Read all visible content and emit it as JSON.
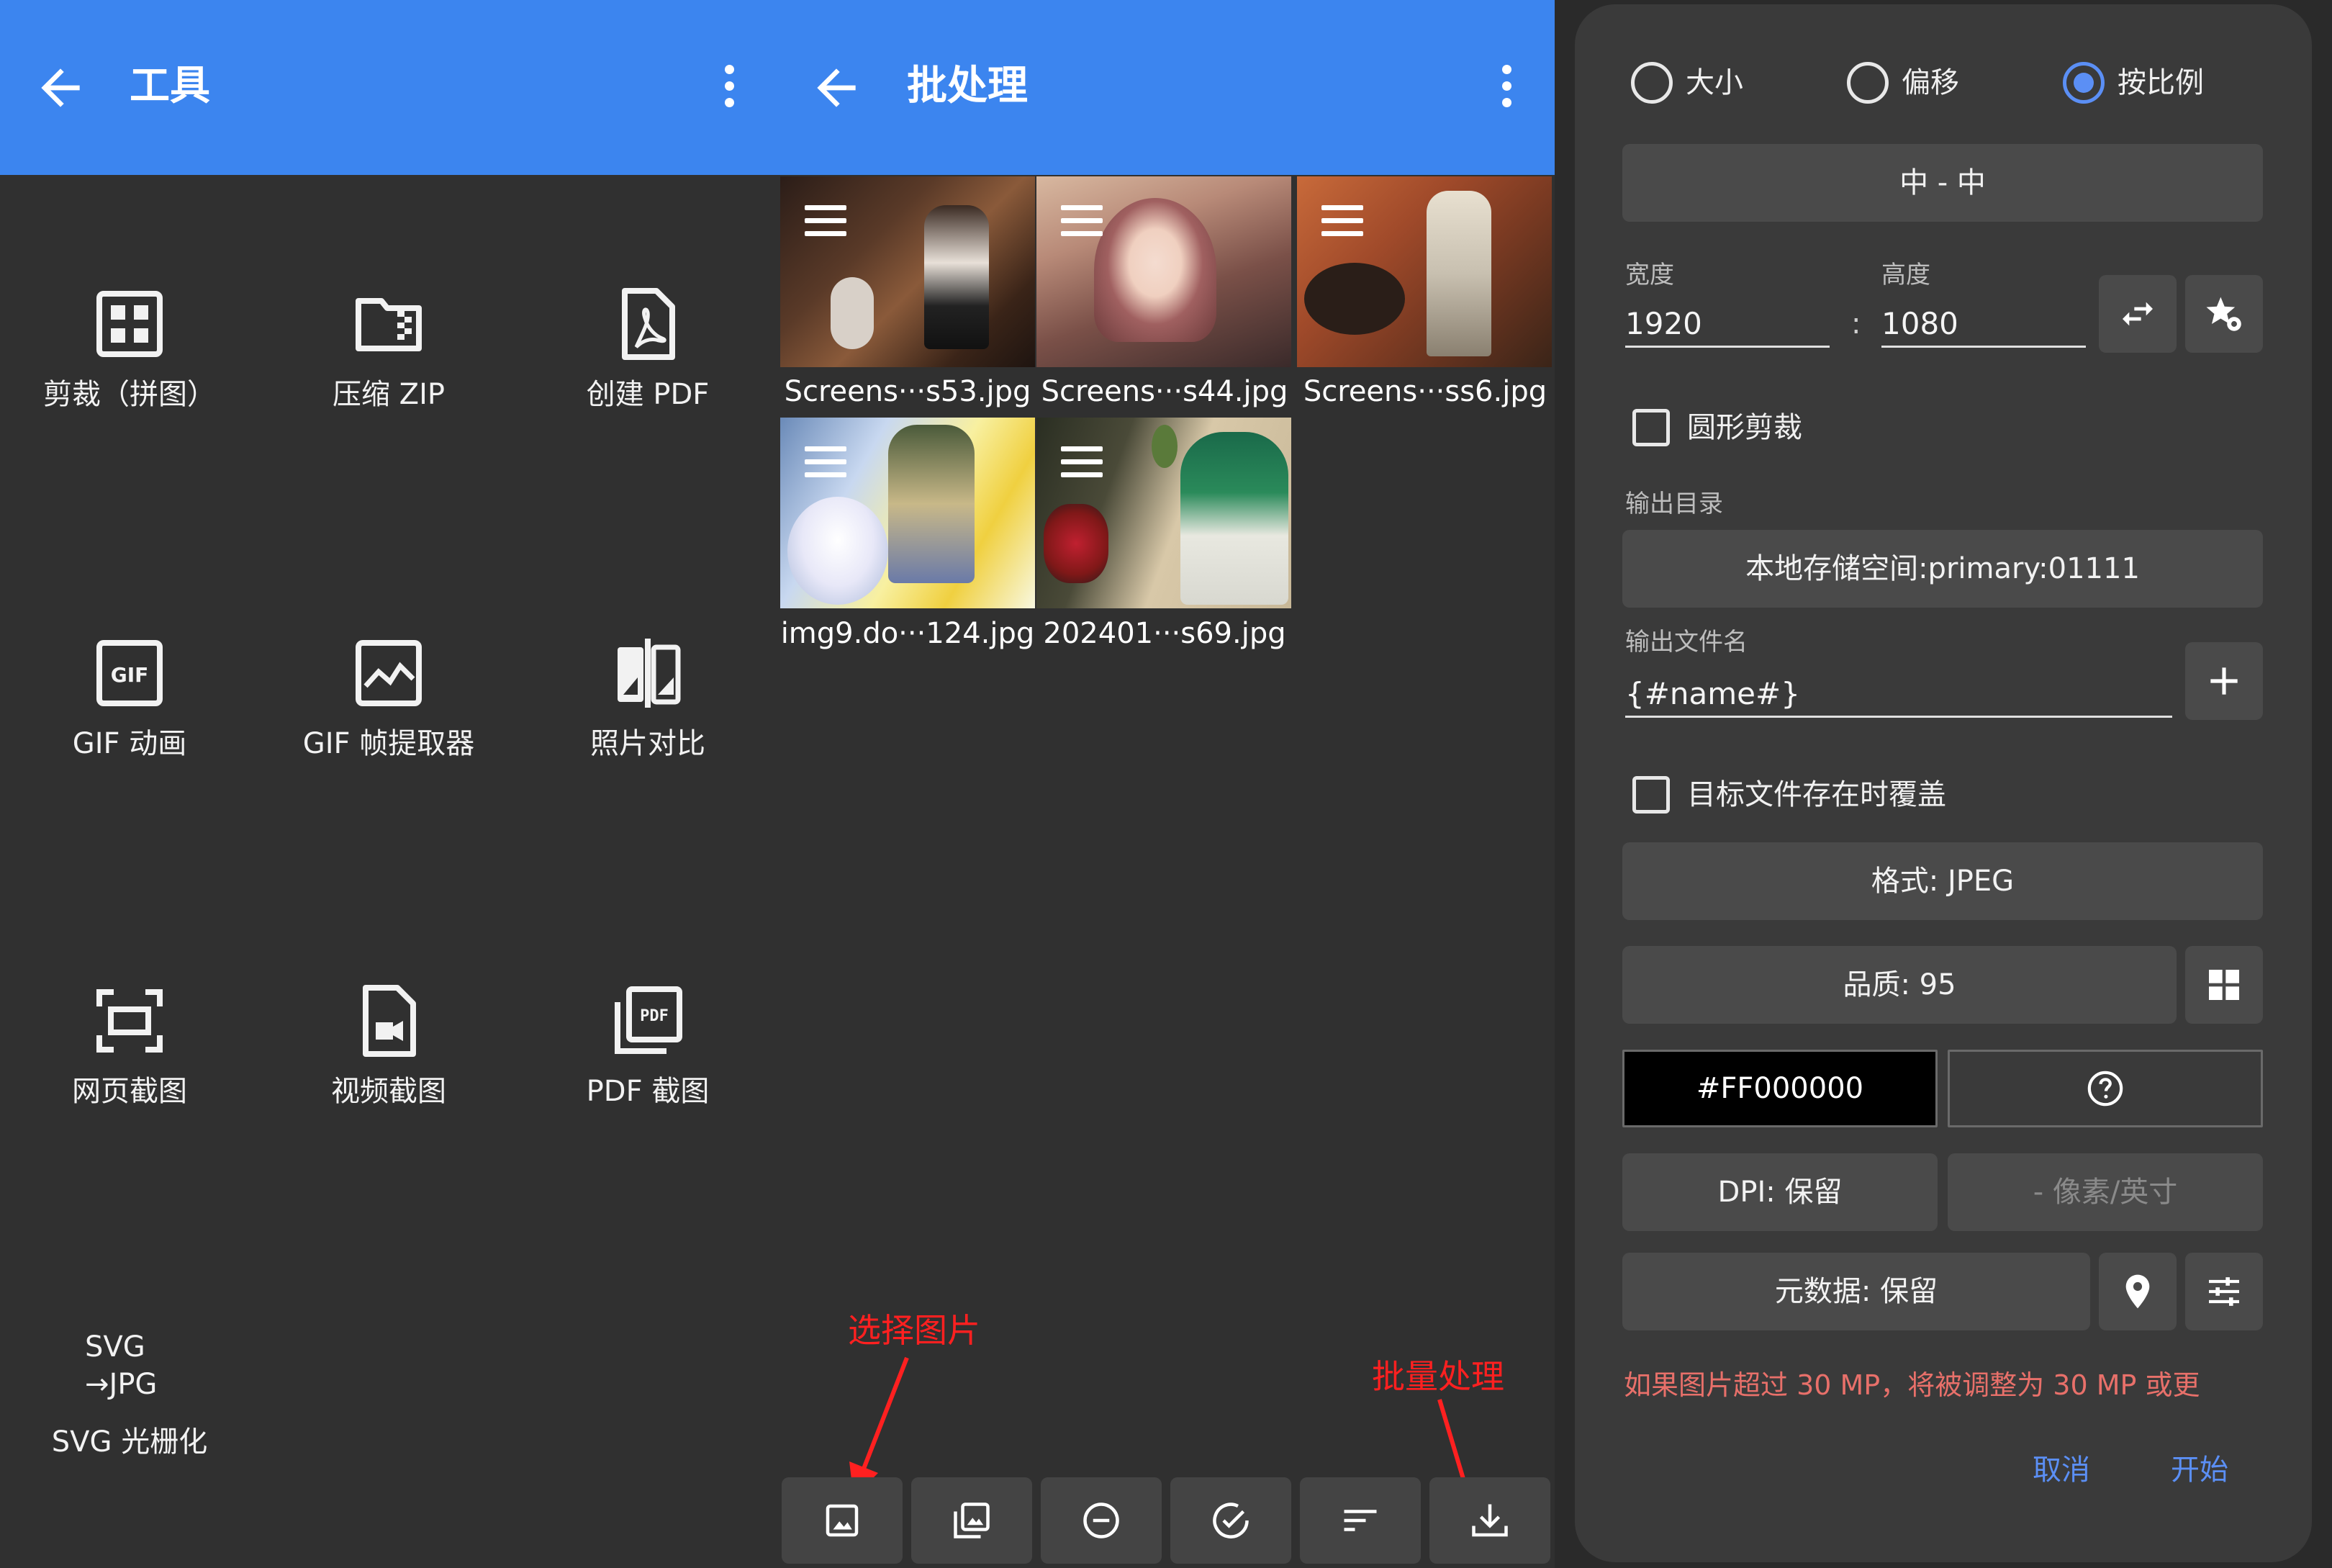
{
  "colors": {
    "appbar": "#3c85ef",
    "background": "#303030",
    "dialog": "#3a3a3a",
    "button": "#4a4a4a",
    "accent": "#5b8ff5",
    "warning": "#e8706a",
    "annotation": "#ff2020"
  },
  "tools_pane": {
    "title": "工具",
    "back_icon": "arrow-left-icon",
    "more_icon": "more-vert-icon",
    "items": [
      {
        "label": "剪裁（拼图）",
        "icon": "grid-icon"
      },
      {
        "label": "压缩 ZIP",
        "icon": "folder-zip-icon"
      },
      {
        "label": "创建 PDF",
        "icon": "pdf-file-icon"
      },
      {
        "label": "GIF 动画",
        "icon": "gif-icon"
      },
      {
        "label": "GIF 帧提取器",
        "icon": "image-frame-icon"
      },
      {
        "label": "照片对比",
        "icon": "compare-icon"
      },
      {
        "label": "网页截图",
        "icon": "screenshot-icon"
      },
      {
        "label": "视频截图",
        "icon": "video-file-icon"
      },
      {
        "label": "PDF 截图",
        "icon": "pdf-stack-icon"
      },
      {
        "label": "SVG 光栅化",
        "icon": "svg-to-jpg-icon",
        "icon_text_1": "SVG",
        "icon_text_2": "→JPG"
      }
    ]
  },
  "batch_pane": {
    "title": "批处理",
    "images": [
      {
        "name": "Screens···s53.jpg"
      },
      {
        "name": "Screens···s44.jpg"
      },
      {
        "name": "Screens···ss6.jpg"
      },
      {
        "name": "img9.do···124.jpg"
      },
      {
        "name": "202401···s69.jpg"
      }
    ],
    "toolbar": [
      {
        "name": "select-image",
        "icon": "image-icon"
      },
      {
        "name": "select-images",
        "icon": "image-multiple-icon"
      },
      {
        "name": "remove",
        "icon": "minus-circle-icon"
      },
      {
        "name": "select-all",
        "icon": "check-circle-icon"
      },
      {
        "name": "sort",
        "icon": "sort-icon"
      },
      {
        "name": "batch-process",
        "icon": "download-icon"
      }
    ],
    "annotations": {
      "select_image": "选择图片",
      "batch_process": "批量处理"
    }
  },
  "dialog": {
    "radios": [
      {
        "label": "大小",
        "checked": false
      },
      {
        "label": "偏移",
        "checked": false
      },
      {
        "label": "按比例",
        "checked": true
      }
    ],
    "gravity_button": "中 - 中",
    "width_label": "宽度",
    "width_value": "1920",
    "separator": ":",
    "height_label": "高度",
    "height_value": "1080",
    "circle_crop_label": "圆形剪裁",
    "circle_crop_checked": false,
    "output_dir_label": "输出目录",
    "output_dir_value": "本地存储空间:primary:01111",
    "output_name_label": "输出文件名",
    "output_name_value": "{#name#}",
    "overwrite_label": "目标文件存在时覆盖",
    "overwrite_checked": false,
    "format_button": "格式: JPEG",
    "quality_button": "品质: 95",
    "color_value": "#FF000000",
    "dpi_button": "DPI: 保留",
    "dpi_unit": "- 像素/英寸",
    "metadata_button": "元数据: 保留",
    "warning_text": "如果图片超过 30 MP，将被调整为 30 MP 或更",
    "cancel": "取消",
    "start": "开始"
  }
}
